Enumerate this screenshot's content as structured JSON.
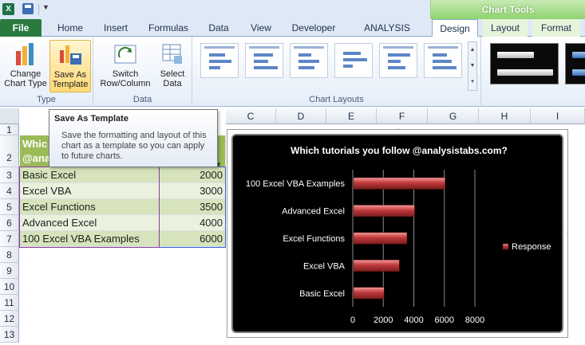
{
  "titlebar": {
    "app_icon": "X",
    "save_icon": "save-icon",
    "customize_icon": "chevron-down-icon"
  },
  "contextual": {
    "title": "Chart Tools"
  },
  "tabs": [
    {
      "label": "File"
    },
    {
      "label": "Home"
    },
    {
      "label": "Insert"
    },
    {
      "label": "Formulas"
    },
    {
      "label": "Data"
    },
    {
      "label": "View"
    },
    {
      "label": "Developer"
    },
    {
      "label": "ANALYSIS TABS"
    },
    {
      "label": "Design"
    },
    {
      "label": "Layout"
    },
    {
      "label": "Format"
    }
  ],
  "ribbon": {
    "type_group": {
      "label": "Type",
      "change_chart_type": "Change Chart Type",
      "save_as_template": "Save As Template"
    },
    "data_group": {
      "label": "Data",
      "switch": "Switch Row/Column",
      "select_data": "Select Data"
    },
    "layouts_group": {
      "label": "Chart Layouts"
    }
  },
  "tooltip": {
    "title": "Save As Template",
    "description": "Save the formatting and layout of this chart as a template so you can apply to future charts."
  },
  "sheet": {
    "columns": [
      "C",
      "D",
      "E",
      "F",
      "G",
      "H",
      "I"
    ],
    "rows": [
      "1",
      "2",
      "3",
      "4",
      "5",
      "6",
      "7",
      "8",
      "9",
      "10",
      "11",
      "12",
      "13"
    ],
    "header_partial": {
      "line1": "Whic",
      "line2": "@ana"
    },
    "table": [
      {
        "name": "Basic Excel",
        "value": "2000"
      },
      {
        "name": "Excel VBA",
        "value": "3000"
      },
      {
        "name": "Excel Functions",
        "value": "3500"
      },
      {
        "name": "Advanced Excel",
        "value": "4000"
      },
      {
        "name": "100 Excel VBA Examples",
        "value": "6000"
      }
    ]
  },
  "chart_data": {
    "type": "bar",
    "title": "Which tutorials you follow  @analysistabs.com?",
    "categories": [
      "Basic Excel",
      "Excel VBA",
      "Excel Functions",
      "Advanced Excel",
      "100 Excel VBA Examples"
    ],
    "series": [
      {
        "name": "Response",
        "values": [
          2000,
          3000,
          3500,
          4000,
          6000
        ]
      }
    ],
    "xlim": [
      0,
      8000
    ],
    "xticks": [
      "0",
      "2000",
      "4000",
      "6000",
      "8000"
    ],
    "grid": true,
    "legend": "right",
    "colors": {
      "bar": "#c0393b",
      "background": "#000000",
      "text": "#ffffff"
    }
  }
}
